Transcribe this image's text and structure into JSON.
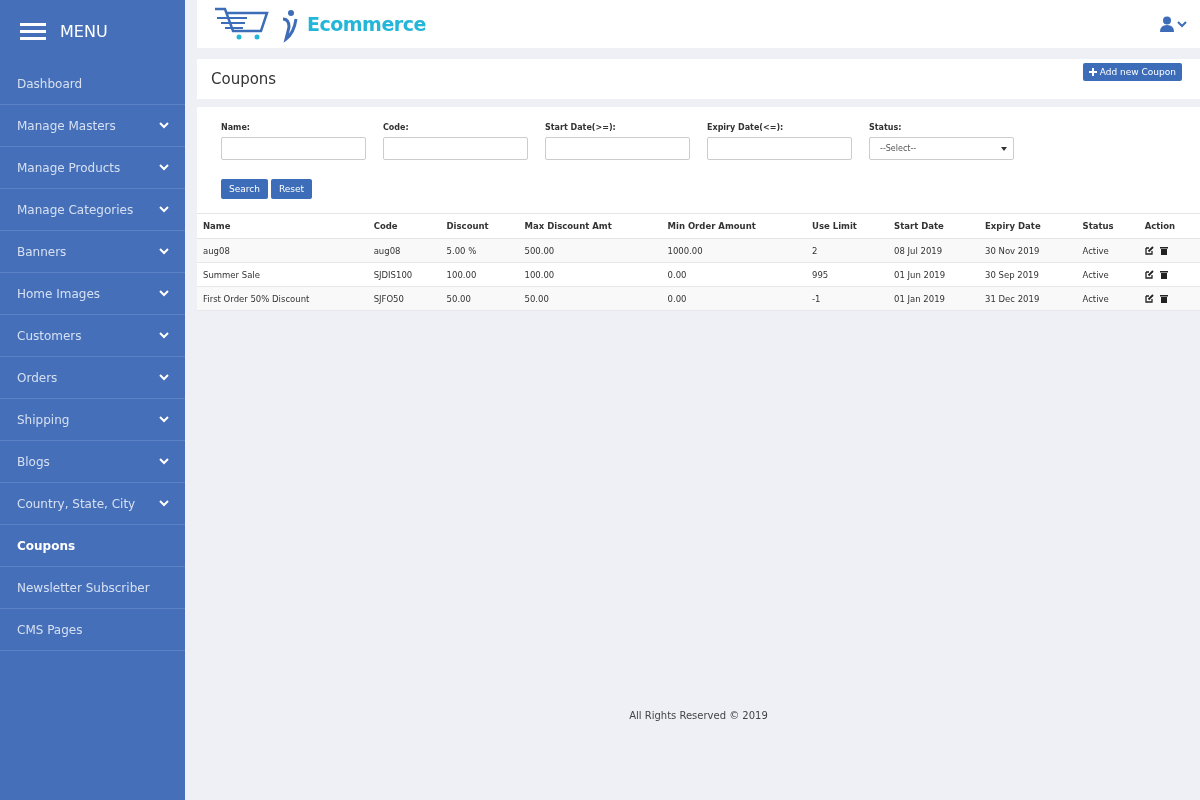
{
  "sidebar": {
    "title": "MENU",
    "items": [
      {
        "label": "Dashboard",
        "kind": "link",
        "selected": false
      },
      {
        "label": "Manage Masters",
        "kind": "dropdown",
        "selected": false
      },
      {
        "label": "Manage Products",
        "kind": "dropdown",
        "selected": false
      },
      {
        "label": "Manage Categories",
        "kind": "dropdown",
        "selected": false
      },
      {
        "label": "Banners",
        "kind": "dropdown",
        "selected": false
      },
      {
        "label": "Home Images",
        "kind": "dropdown",
        "selected": false
      },
      {
        "label": "Customers",
        "kind": "dropdown",
        "selected": false
      },
      {
        "label": "Orders",
        "kind": "dropdown",
        "selected": false
      },
      {
        "label": "Shipping",
        "kind": "dropdown",
        "selected": false
      },
      {
        "label": "Blogs",
        "kind": "dropdown",
        "selected": false
      },
      {
        "label": "Country, State, City",
        "kind": "dropdown",
        "selected": false
      },
      {
        "label": "Coupons",
        "kind": "link",
        "selected": true
      },
      {
        "label": "Newsletter Subscriber",
        "kind": "link",
        "selected": false
      },
      {
        "label": "CMS Pages",
        "kind": "link",
        "selected": false
      }
    ]
  },
  "header": {
    "logo": "Ecommerce"
  },
  "page": {
    "title": "Coupons",
    "add_button": "Add new Coupon"
  },
  "filters": {
    "fields": [
      {
        "label": "Name:",
        "kind": "text"
      },
      {
        "label": "Code:",
        "kind": "text"
      },
      {
        "label": "Start Date(>=):",
        "kind": "text"
      },
      {
        "label": "Expiry Date(<=):",
        "kind": "text"
      },
      {
        "label": "Status:",
        "kind": "select",
        "value": "--Select--"
      }
    ],
    "buttons": [
      "Search",
      "Reset"
    ]
  },
  "table": {
    "columns": [
      "Name",
      "Code",
      "Discount",
      "Max Discount Amt",
      "Min Order Amount",
      "Use Limit",
      "Start Date",
      "Expiry Date",
      "Status",
      "Action"
    ],
    "rows": [
      [
        "aug08",
        "aug08",
        "5.00 %",
        "500.00",
        "1000.00",
        "2",
        "08 Jul 2019",
        "30 Nov 2019",
        "Active"
      ],
      [
        "Summer Sale",
        "SJDIS100",
        "100.00",
        "100.00",
        "0.00",
        "995",
        "01 Jun 2019",
        "30 Sep 2019",
        "Active"
      ],
      [
        "First Order 50% Discount",
        "SJFO50",
        "50.00",
        "50.00",
        "0.00",
        "-1",
        "01 Jan 2019",
        "31 Dec 2019",
        "Active"
      ]
    ]
  },
  "footer": "All Rights Reserved © 2019"
}
